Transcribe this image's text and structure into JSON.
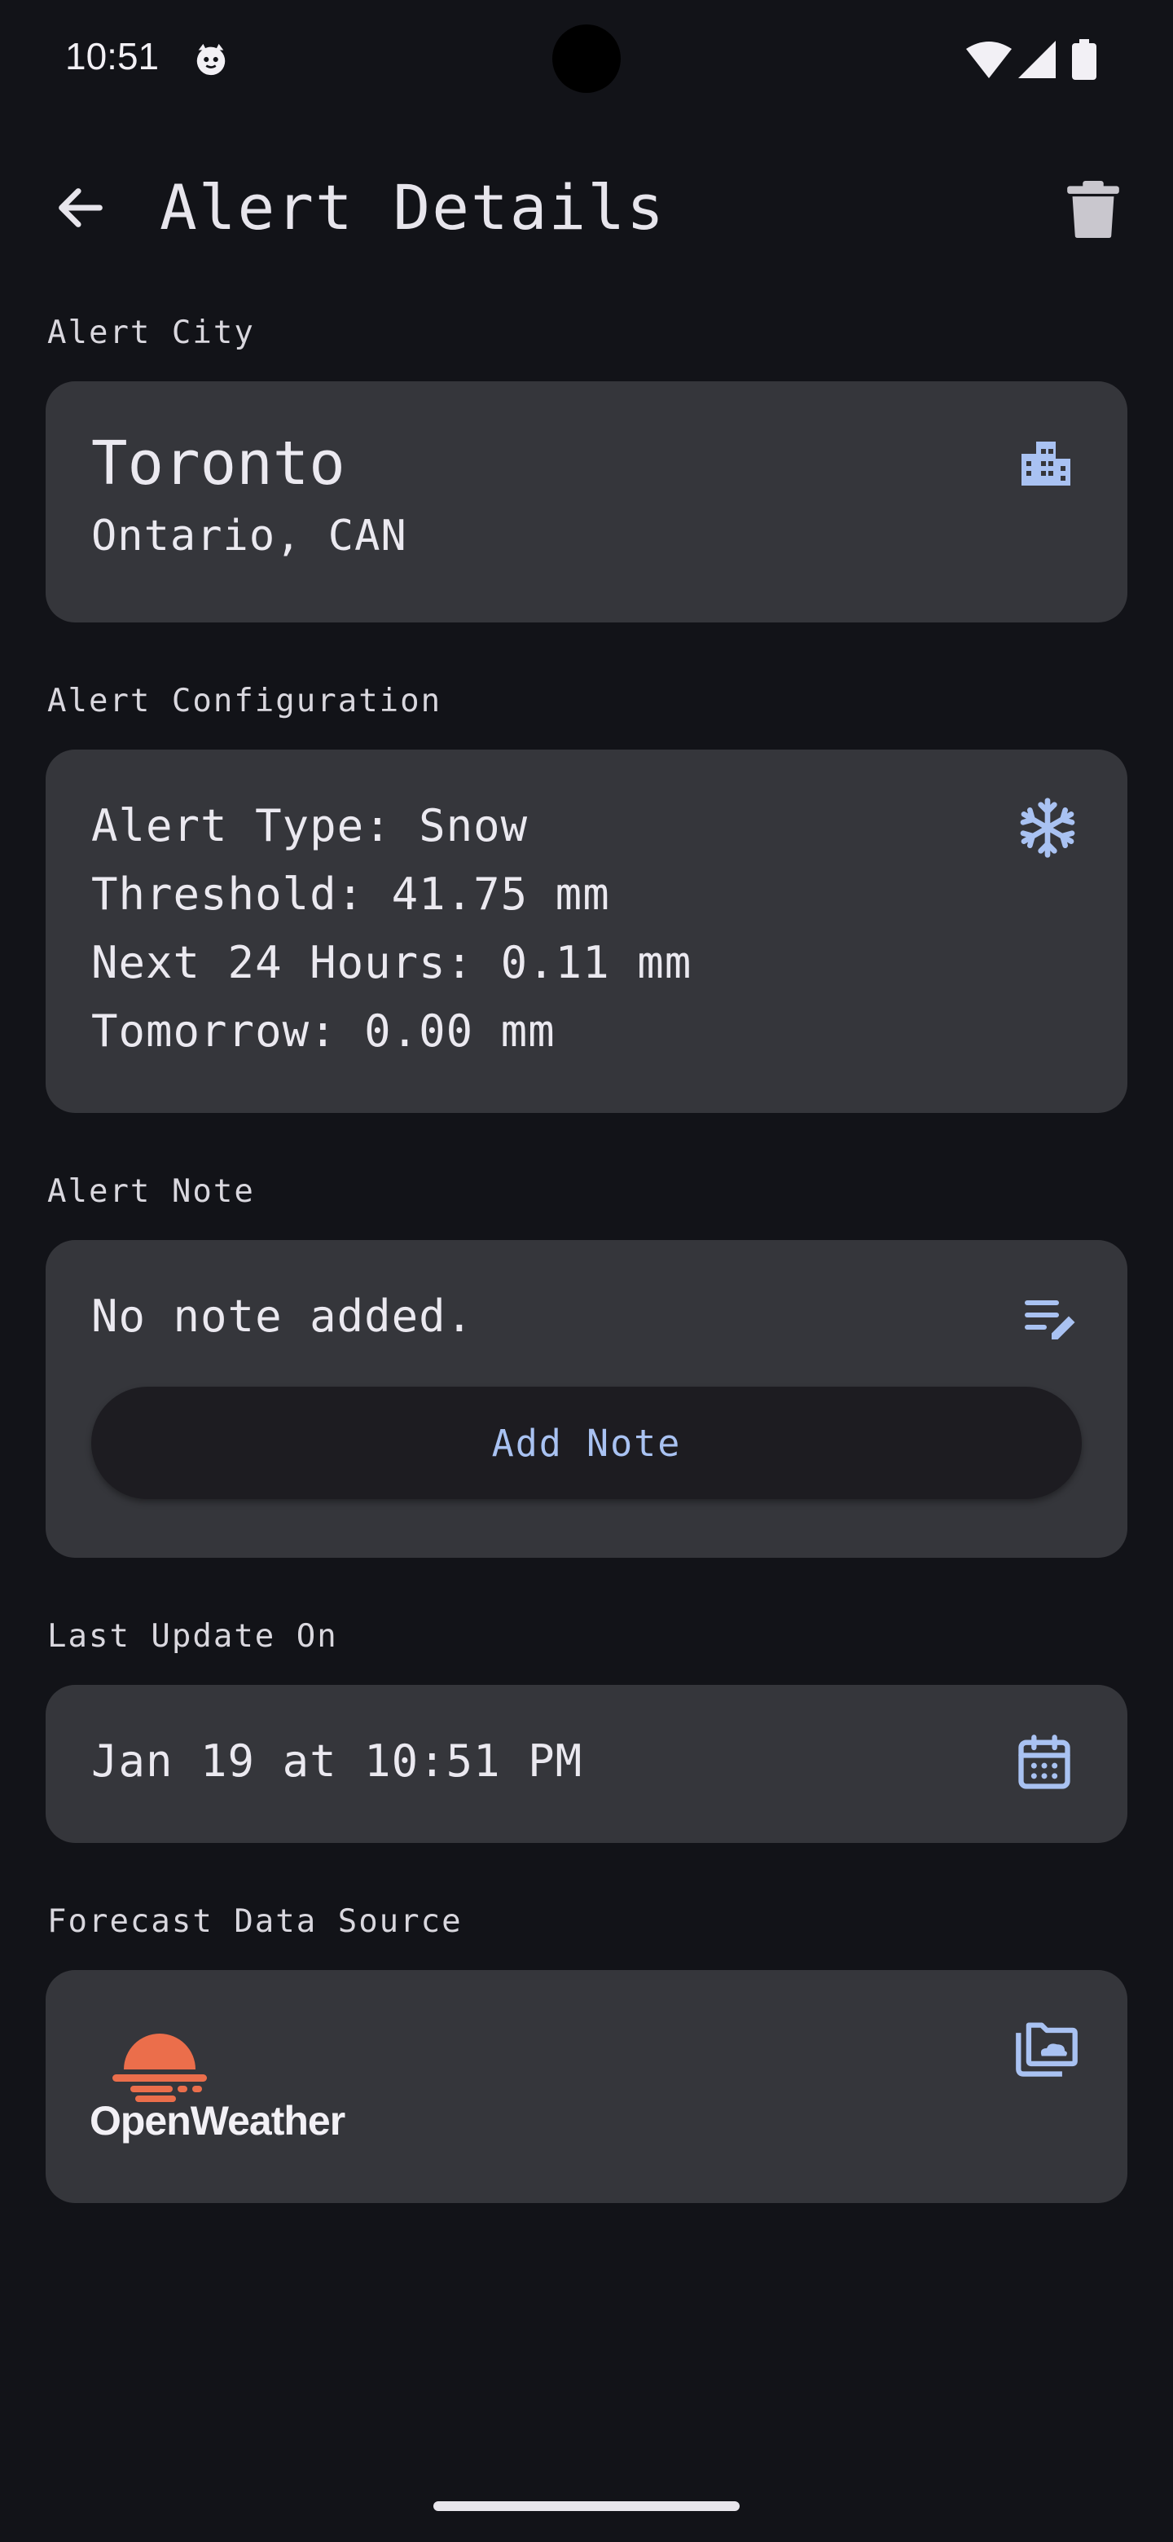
{
  "status_bar": {
    "time": "10:51"
  },
  "app_bar": {
    "title": "Alert Details"
  },
  "city_section": {
    "label": "Alert City",
    "city": "Toronto",
    "region": "Ontario, CAN"
  },
  "config_section": {
    "label": "Alert Configuration",
    "lines": [
      "Alert Type: Snow",
      "Threshold: 41.75 mm",
      "Next 24 Hours: 0.11 mm",
      "Tomorrow: 0.00 mm"
    ]
  },
  "note_section": {
    "label": "Alert Note",
    "text": "No note added.",
    "button_label": "Add Note"
  },
  "update_section": {
    "label": "Last Update On",
    "value": "Jan 19 at 10:51 PM"
  },
  "source_section": {
    "label": "Forecast Data Source",
    "logo_text": "OpenWeather"
  },
  "colors": {
    "background": "#121318",
    "card": "#35363b",
    "accent": "#a9c2f2",
    "logo": "#eb6e4b"
  },
  "icons": [
    "back-arrow-icon",
    "trash-icon",
    "city-buildings-icon",
    "snowflake-icon",
    "edit-note-icon",
    "calendar-icon",
    "cloud-folder-icon"
  ]
}
